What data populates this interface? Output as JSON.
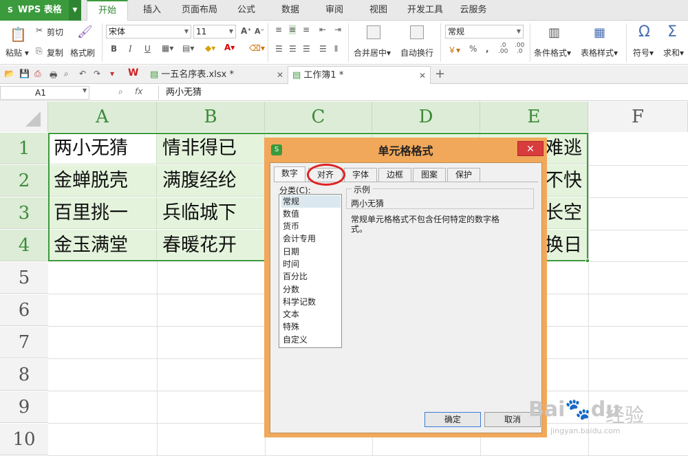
{
  "app": {
    "name": "WPS 表格"
  },
  "ribbon_tabs": [
    "开始",
    "插入",
    "页面布局",
    "公式",
    "数据",
    "审阅",
    "视图",
    "开发工具",
    "云服务"
  ],
  "ribbon": {
    "paste": "粘贴",
    "cut": "剪切",
    "copy": "复制",
    "format_painter": "格式刷",
    "font_name": "宋体",
    "font_size": "11",
    "bold": "B",
    "italic": "I",
    "underline": "U",
    "merge_center": "合并居中",
    "wrap_text": "自动换行",
    "number_format": "常规",
    "percent": "%",
    "comma": ",",
    "conditional_format": "条件格式",
    "table_style": "表格样式",
    "symbol": "符号",
    "sum": "求和",
    "omega": "Ω",
    "sigma": "Σ"
  },
  "doc_tabs": [
    {
      "label": "一五名序表.xlsx *"
    },
    {
      "label": "工作簿1 *"
    }
  ],
  "formula_bar": {
    "name_box": "A1",
    "fx": "fx",
    "content": "两小无猜"
  },
  "columns": [
    "A",
    "B",
    "C",
    "D",
    "E",
    "F"
  ],
  "rows": [
    "1",
    "2",
    "3",
    "4",
    "5",
    "6",
    "7",
    "8",
    "9",
    "10"
  ],
  "cells": {
    "col_a": [
      "两小无猜",
      "金蝉脱壳",
      "百里挑一",
      "金玉满堂"
    ],
    "col_b": [
      "情非得已",
      "满腹经纶",
      "兵临城下",
      "春暖花开"
    ],
    "col_e_visible": [
      "难逃",
      "不快",
      "长空",
      "换日"
    ]
  },
  "dialog": {
    "title": "单元格格式",
    "close": "✕",
    "tabs": [
      "数字",
      "对齐",
      "字体",
      "边框",
      "图案",
      "保护"
    ],
    "category_label": "分类(C):",
    "categories": [
      "常规",
      "数值",
      "货币",
      "会计专用",
      "日期",
      "时间",
      "百分比",
      "分数",
      "科学记数",
      "文本",
      "特殊",
      "自定义"
    ],
    "sample_label": "示例",
    "sample_value": "两小无猜",
    "description": "常规单元格格式不包含任何特定的数字格式。",
    "ok": "确定",
    "cancel": "取消"
  },
  "watermark": {
    "logo": "Bai",
    "du": "du",
    "text": "经验",
    "url": "jingyan.baidu.com"
  }
}
